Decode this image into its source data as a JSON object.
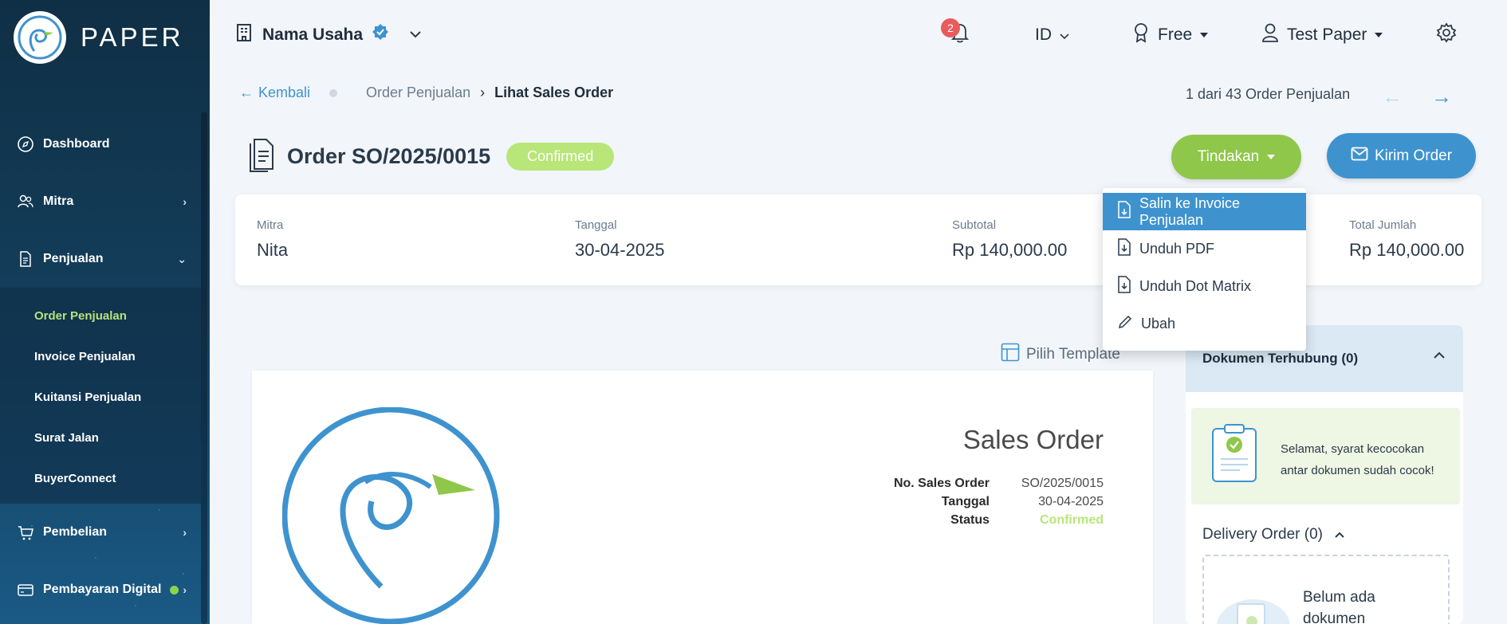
{
  "sidebar": {
    "brand": "PAPER",
    "items": [
      {
        "label": "Dashboard"
      },
      {
        "label": "Mitra"
      },
      {
        "label": "Penjualan"
      },
      {
        "label": "Pembelian"
      },
      {
        "label": "Pembayaran Digital"
      }
    ],
    "penjualan_sub": [
      {
        "label": "Order Penjualan",
        "active": true
      },
      {
        "label": "Invoice Penjualan"
      },
      {
        "label": "Kuitansi Penjualan"
      },
      {
        "label": "Surat Jalan"
      },
      {
        "label": "BuyerConnect"
      }
    ]
  },
  "topbar": {
    "business_name": "Nama Usaha",
    "notification_count": "2",
    "language": "ID",
    "plan": "Free",
    "user": "Test Paper"
  },
  "breadcrumb": {
    "back": "Kembali",
    "parent": "Order Penjualan",
    "current": "Lihat Sales Order",
    "pager": "1 dari 43 Order Penjualan"
  },
  "order": {
    "title": "Order SO/2025/0015",
    "status": "Confirmed"
  },
  "actions": {
    "tindakan": "Tindakan",
    "kirim": "Kirim Order",
    "menu": [
      "Salin ke Invoice Penjualan",
      "Unduh PDF",
      "Unduh Dot Matrix",
      "Ubah"
    ]
  },
  "summary": {
    "mitra_label": "Mitra",
    "mitra": "Nita",
    "tanggal_label": "Tanggal",
    "tanggal": "30-04-2025",
    "subtotal_label": "Subtotal",
    "subtotal": "Rp 140,000.00",
    "total_label": "Total Jumlah",
    "total": "Rp 140,000.00"
  },
  "document": {
    "pilih_template": "Pilih Template",
    "title": "Sales Order",
    "no_label": "No. Sales Order",
    "no": "SO/2025/0015",
    "tanggal_label": "Tanggal",
    "tanggal": "30-04-2025",
    "status_label": "Status",
    "status": "Confirmed"
  },
  "right_panel": {
    "header": "Dokumen Terhubung (0)",
    "match_line1": "Selamat, syarat kecocokan",
    "match_line2": "antar dokumen sudah cocok!",
    "delivery_order": "Delivery Order (0)",
    "empty_line1": "Belum ada",
    "empty_line2": "dokumen"
  },
  "colors": {
    "primary": "#3e93cf",
    "action_green": "#8fc74a",
    "status_green": "#b8e678",
    "sidebar_active": "#b7e27a"
  }
}
